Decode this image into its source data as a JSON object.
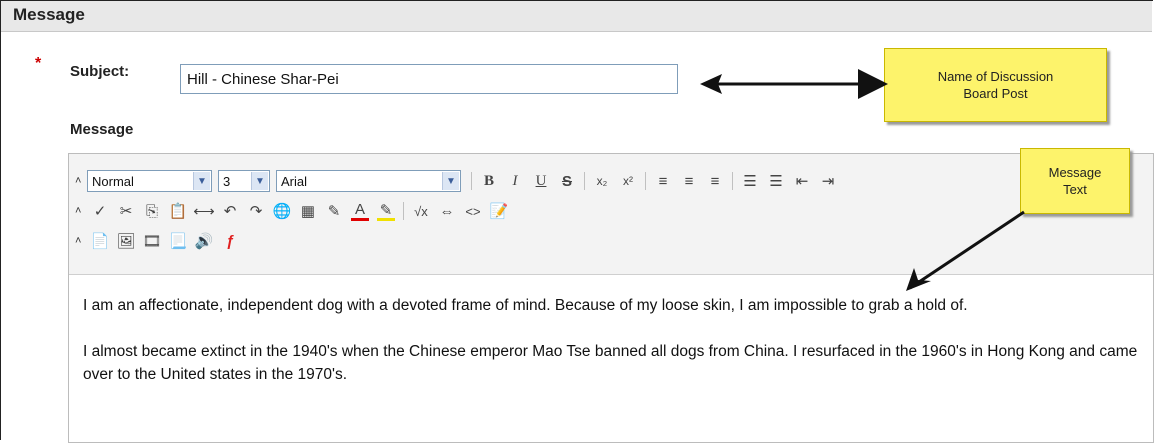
{
  "section": {
    "title": "Message"
  },
  "form": {
    "required_mark": "*",
    "subject_label": "Subject:",
    "subject_value": "Hill - Chinese Shar-Pei",
    "message_label": "Message"
  },
  "toolbar": {
    "collapse_glyph": "˄",
    "format_select": "Normal",
    "size_select": "3",
    "font_select": "Arial",
    "row1_buttons": [
      {
        "icon": "bold-icon",
        "glyph": "B"
      },
      {
        "icon": "italic-icon",
        "glyph": "I"
      },
      {
        "icon": "underline-icon",
        "glyph": "U"
      },
      {
        "icon": "strikethrough-icon",
        "glyph": "S"
      },
      {
        "icon": "subscript-icon",
        "glyph": "x₂"
      },
      {
        "icon": "superscript-icon",
        "glyph": "x²"
      },
      {
        "icon": "align-left-icon",
        "glyph": "≡"
      },
      {
        "icon": "align-center-icon",
        "glyph": "≡"
      },
      {
        "icon": "align-right-icon",
        "glyph": "≡"
      },
      {
        "icon": "ordered-list-icon",
        "glyph": "☰"
      },
      {
        "icon": "bullet-list-icon",
        "glyph": "☰"
      },
      {
        "icon": "outdent-icon",
        "glyph": "⇤"
      },
      {
        "icon": "indent-icon",
        "glyph": "⇥"
      }
    ],
    "row2_buttons": [
      {
        "icon": "spellcheck-icon",
        "glyph": "✓"
      },
      {
        "icon": "cut-icon",
        "glyph": "✂"
      },
      {
        "icon": "copy-icon",
        "glyph": "⎘"
      },
      {
        "icon": "paste-icon",
        "glyph": "📋"
      },
      {
        "icon": "unlink-icon",
        "glyph": "⟷"
      },
      {
        "icon": "undo-icon",
        "glyph": "↶"
      },
      {
        "icon": "redo-icon",
        "glyph": "↷"
      },
      {
        "icon": "insert-link-icon",
        "glyph": "🌐"
      },
      {
        "icon": "insert-table-icon",
        "glyph": "▦"
      },
      {
        "icon": "highlight-pen-icon",
        "glyph": "✎"
      },
      {
        "icon": "text-color-icon",
        "glyph": "A"
      },
      {
        "icon": "background-color-icon",
        "glyph": "✎"
      },
      {
        "icon": "equation-icon",
        "glyph": "√x"
      },
      {
        "icon": "embed-icon",
        "glyph": "⇔"
      },
      {
        "icon": "html-source-icon",
        "glyph": "<>"
      },
      {
        "icon": "preview-icon",
        "glyph": "📝"
      }
    ],
    "row3_buttons": [
      {
        "icon": "attach-file-icon",
        "glyph": "📄"
      },
      {
        "icon": "insert-image-icon",
        "glyph": "🖼"
      },
      {
        "icon": "insert-media-icon",
        "glyph": "🎞"
      },
      {
        "icon": "insert-document-icon",
        "glyph": "📃"
      },
      {
        "icon": "insert-audio-icon",
        "glyph": "🔊"
      },
      {
        "icon": "insert-flash-icon",
        "glyph": "ƒ"
      }
    ]
  },
  "editor": {
    "paragraphs": [
      "I am an affectionate, independent dog with a devoted frame of mind. Because of my loose skin, I am impossible to grab a hold of.",
      "I almost became extinct in the 1940's when the Chinese emperor Mao Tse banned all dogs from China. I resurfaced in the 1960's in Hong Kong and came over to the United states in the 1970's."
    ]
  },
  "callouts": {
    "subject_note": "Name of Discussion Board Post",
    "message_note": "Message Text"
  },
  "colors": {
    "callout_bg": "#fdf36b",
    "required": "#cc0000",
    "text_color_underline": "#e00000",
    "highlight_underline": "#f0e000",
    "flash_icon": "#e02020"
  }
}
